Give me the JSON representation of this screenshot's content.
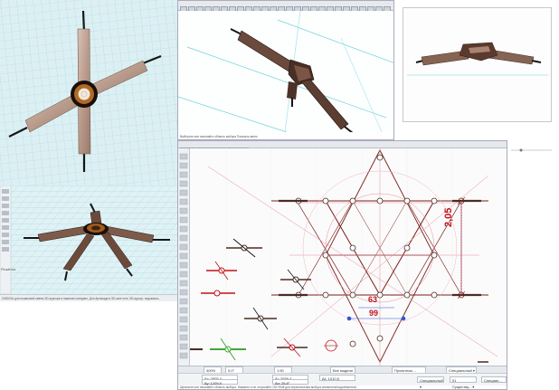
{
  "colors": {
    "grid_bg": "#d9eef2",
    "grid_line": "#a8d6de",
    "beam_fill": "#a2826e",
    "beam_dark": "#4a2c22",
    "hub_ring": "#a55a18",
    "rod": "#161616",
    "plan_line": "#7a1c18",
    "dim_red": "#c0131a",
    "dim_blue": "#2f55d4",
    "guide_cyan": "#6fd3dc",
    "selected_green": "#43a83a"
  },
  "plan_window": {
    "dimensions": {
      "vertical": "2,05",
      "upper": "63",
      "lower": "99"
    },
    "statusbar": {
      "zoom": "400%",
      "angle": "0,0°",
      "layer": "1:50",
      "field_x": "∆x: 2505,4",
      "field_y": "∆y: 1209,9",
      "field_r": "∆r: 2659,4",
      "field_a": "∆α: 25,8°",
      "field_z": "∆z: 1010,5",
      "dropdown_1": "Все модели ▾",
      "dropdown_2": "Проектная ...",
      "dropdown_3": "Специальный ▾",
      "dropdown_4": "Специальный ▾",
      "dropdown_5": "01 Существу... ▾",
      "dropdown_6": "Специал...",
      "hint": "Щелкните или начинайте область выбора. Нажмите и не отпускайте Ctrl+Shift для переключения выбора элементов/подэлементов."
    }
  },
  "top_left_statusbar": "CMD/Ctrl для пошаговой смены 3D-курсора и нажатия соседних. Для Архикада в 3D-окне есть 3D-курсор, подсказка...",
  "top_middle_toolbar_hint": "Выберите или начинайте область выбора Показать меню",
  "side_label": "Решётка"
}
